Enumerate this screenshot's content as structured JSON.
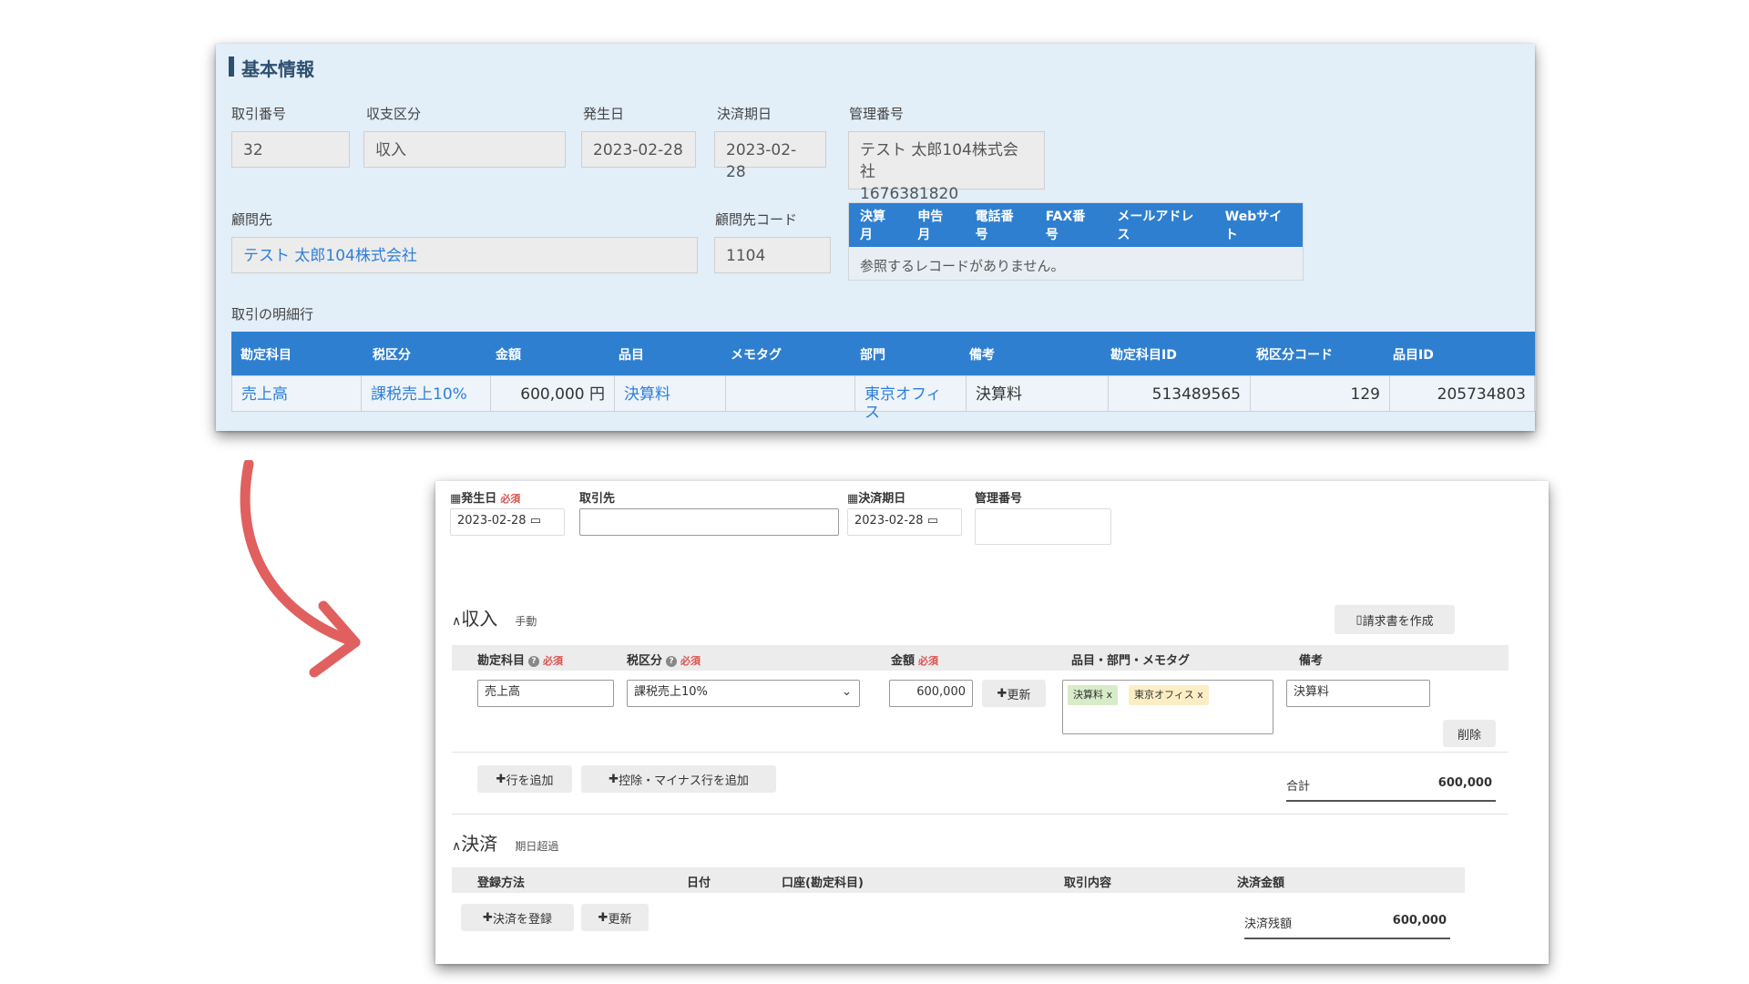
{
  "top": {
    "section_title": "基本情報",
    "fields": {
      "torihiki_no": {
        "label": "取引番号",
        "value": "32"
      },
      "shushi": {
        "label": "収支区分",
        "value": "収入"
      },
      "hasseibi": {
        "label": "発生日",
        "value": "2023-02-28"
      },
      "kessai_kijitsu": {
        "label": "決済期日",
        "value": "2023-02-28"
      },
      "kanri_no": {
        "label": "管理番号",
        "value_line1": "テスト 太郎104株式会社",
        "value_line2": "1676381820"
      },
      "client": {
        "label": "顧問先",
        "value": "テスト 太郎104株式会社"
      },
      "client_code": {
        "label": "顧問先コード",
        "value": "1104"
      }
    },
    "ref_table": {
      "headers": [
        "決算月",
        "申告月",
        "電話番号",
        "FAX番号",
        "メールアドレス",
        "Webサイト"
      ],
      "empty_message": "参照するレコードがありません。"
    },
    "detail": {
      "label": "取引の明細行",
      "headers": [
        "勘定科目",
        "税区分",
        "金額",
        "品目",
        "メモタグ",
        "部門",
        "備考",
        "勘定科目ID",
        "税区分コード",
        "品目ID"
      ],
      "row": {
        "account": "売上高",
        "tax": "課税売上10%",
        "amount": "600,000 円",
        "item": "決算料",
        "memo": "",
        "dept": "東京オフィス",
        "note": "決算料",
        "account_id": "513489565",
        "tax_code": "129",
        "item_id": "205734803"
      }
    }
  },
  "bottom": {
    "header_fields": {
      "hasseibi_label": "発生日",
      "required": "必須",
      "hasseibi_value": "2023-02-28",
      "torihikisaki_label": "取引先",
      "torihikisaki_value": "",
      "kessai_label": "決済期日",
      "kessai_value": "2023-02-28",
      "kanri_label": "管理番号",
      "kanri_value": ""
    },
    "income": {
      "title": "収入",
      "mode": "手動",
      "invoice_button": "請求書を作成",
      "columns": {
        "account": "勘定科目",
        "tax": "税区分",
        "amount": "金額",
        "tags": "品目・部門・メモタグ",
        "note": "備考"
      },
      "row": {
        "account": "売上高",
        "tax": "課税売上10%",
        "amount": "600,000",
        "update_button": "更新",
        "tag1": "決算料 x",
        "tag2": "東京オフィス x",
        "note": "決算料",
        "delete_button": "削除"
      },
      "add_row_button": "行を追加",
      "add_minus_button": "控除・マイナス行を追加",
      "total_label": "合計",
      "total_value": "600,000"
    },
    "settlement": {
      "title": "決済",
      "status": "期日超過",
      "columns": [
        "登録方法",
        "日付",
        "口座(勘定科目)",
        "取引内容",
        "決済金額"
      ],
      "register_button": "決済を登録",
      "update_button": "更新",
      "balance_label": "決済残額",
      "balance_value": "600,000"
    }
  },
  "colors": {
    "panel_bg": "#e2eef8",
    "header_blue": "#2f7fd0",
    "link_blue": "#2f7fd8",
    "arrow_red": "#e0605f",
    "required_red": "#d9534f"
  }
}
